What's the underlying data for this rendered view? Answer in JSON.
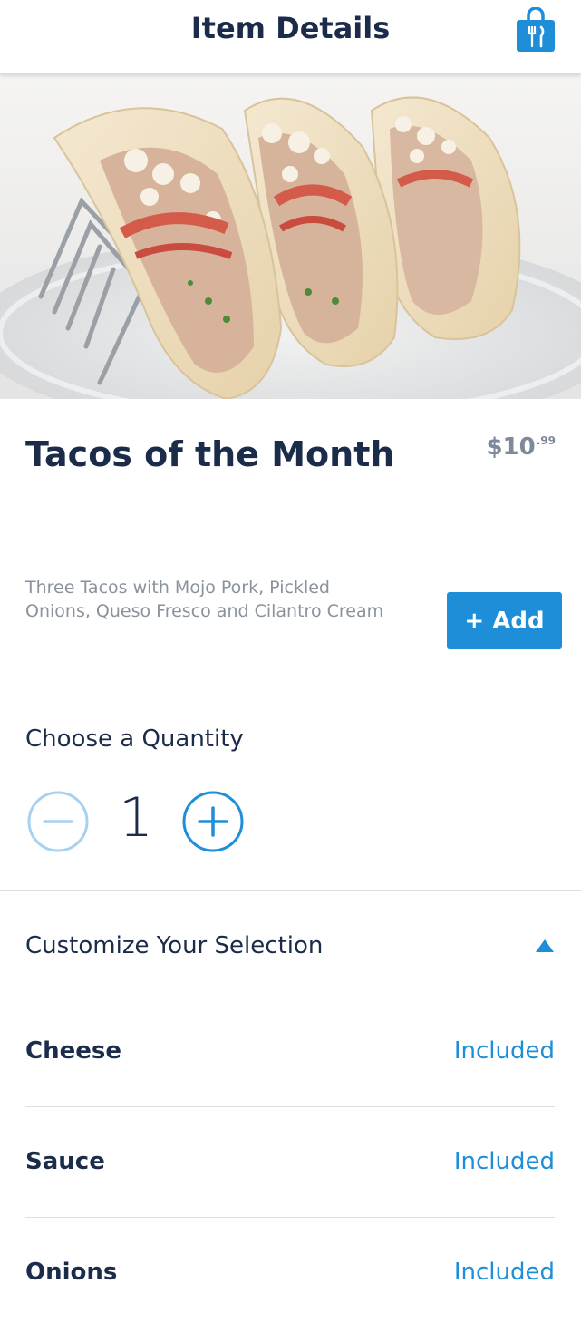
{
  "header": {
    "title": "Item Details",
    "bag_icon": "shopping-bag-utensils-icon"
  },
  "item": {
    "name": "Tacos of the Month",
    "price_dollars": "$10",
    "price_cents": ".99",
    "description": "Three Tacos with Mojo Pork, Pickled Onions, Queso Fresco and Cilantro Cream",
    "add_label": "+ Add"
  },
  "quantity": {
    "label": "Choose a Quantity",
    "value": "1",
    "decrement_icon": "minus-circle-icon",
    "increment_icon": "plus-circle-icon"
  },
  "customize": {
    "label": "Customize Your Selection",
    "toggle_icon": "caret-up-icon",
    "options": [
      {
        "name": "Cheese",
        "value": "Included"
      },
      {
        "name": "Sauce",
        "value": "Included"
      },
      {
        "name": "Onions",
        "value": "Included"
      }
    ]
  },
  "colors": {
    "brand_blue": "#1f8ed8",
    "navy": "#1b2b4a",
    "muted": "#8a929c"
  }
}
